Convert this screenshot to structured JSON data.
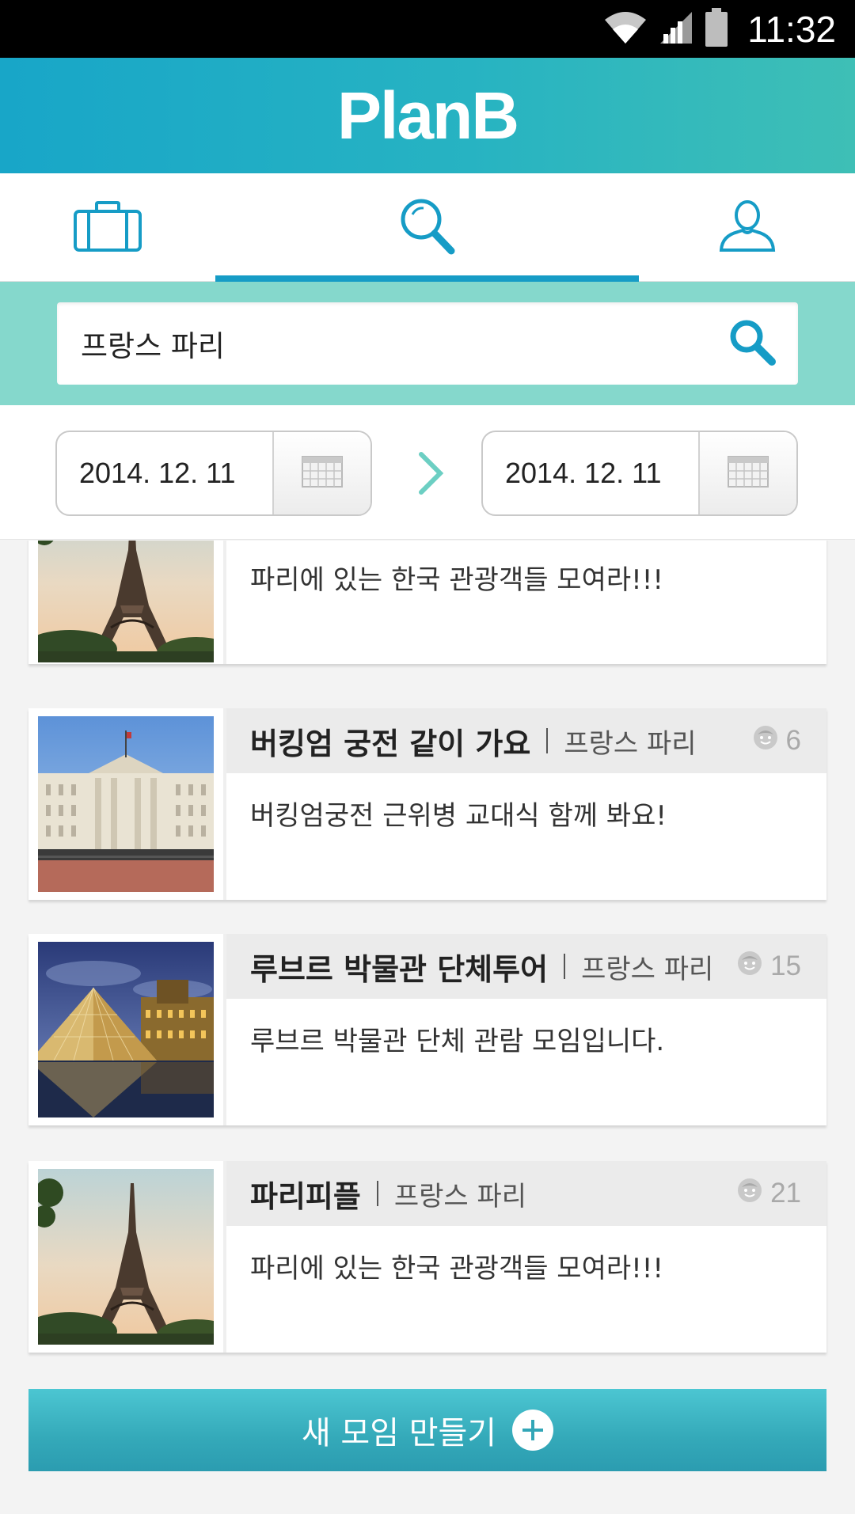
{
  "status_bar": {
    "time": "11:32",
    "icons": [
      "wifi-icon",
      "cellular-signal-icon",
      "battery-icon"
    ]
  },
  "header": {
    "logo": "PlanB",
    "colors": {
      "gradient_start": "#18a6c8",
      "gradient_end": "#3ebfb6"
    }
  },
  "tabs": [
    {
      "icon": "suitcase-icon",
      "selected": false
    },
    {
      "icon": "search-icon",
      "selected": true
    },
    {
      "icon": "person-icon",
      "selected": false
    }
  ],
  "search": {
    "value": "프랑스 파리",
    "band_color": "#85d8cc",
    "accent_color": "#169cc6"
  },
  "dates": {
    "start": "2014. 12. 11",
    "end": "2014. 12. 11"
  },
  "meetups": [
    {
      "title": "",
      "location": "",
      "count": "",
      "description": "파리에 있는 한국 관광객들 모여라!!!",
      "image": "eiffel-tower"
    },
    {
      "title": "버킹엄 궁전 같이 가요",
      "location": "프랑스 파리",
      "count": "6",
      "description": "버킹엄궁전 근위병 교대식 함께 봐요!",
      "image": "buckingham-palace"
    },
    {
      "title": "루브르 박물관 단체투어",
      "location": "프랑스 파리",
      "count": "15",
      "description": "루브르 박물관 단체 관람 모임입니다.",
      "image": "louvre-pyramid"
    },
    {
      "title": "파리피플",
      "location": "프랑스 파리",
      "count": "21",
      "description": "파리에 있는 한국 관광객들 모여라!!!",
      "image": "eiffel-tower"
    }
  ],
  "create_button": {
    "label": "새 모임 만들기",
    "icon": "plus-circle-icon"
  }
}
